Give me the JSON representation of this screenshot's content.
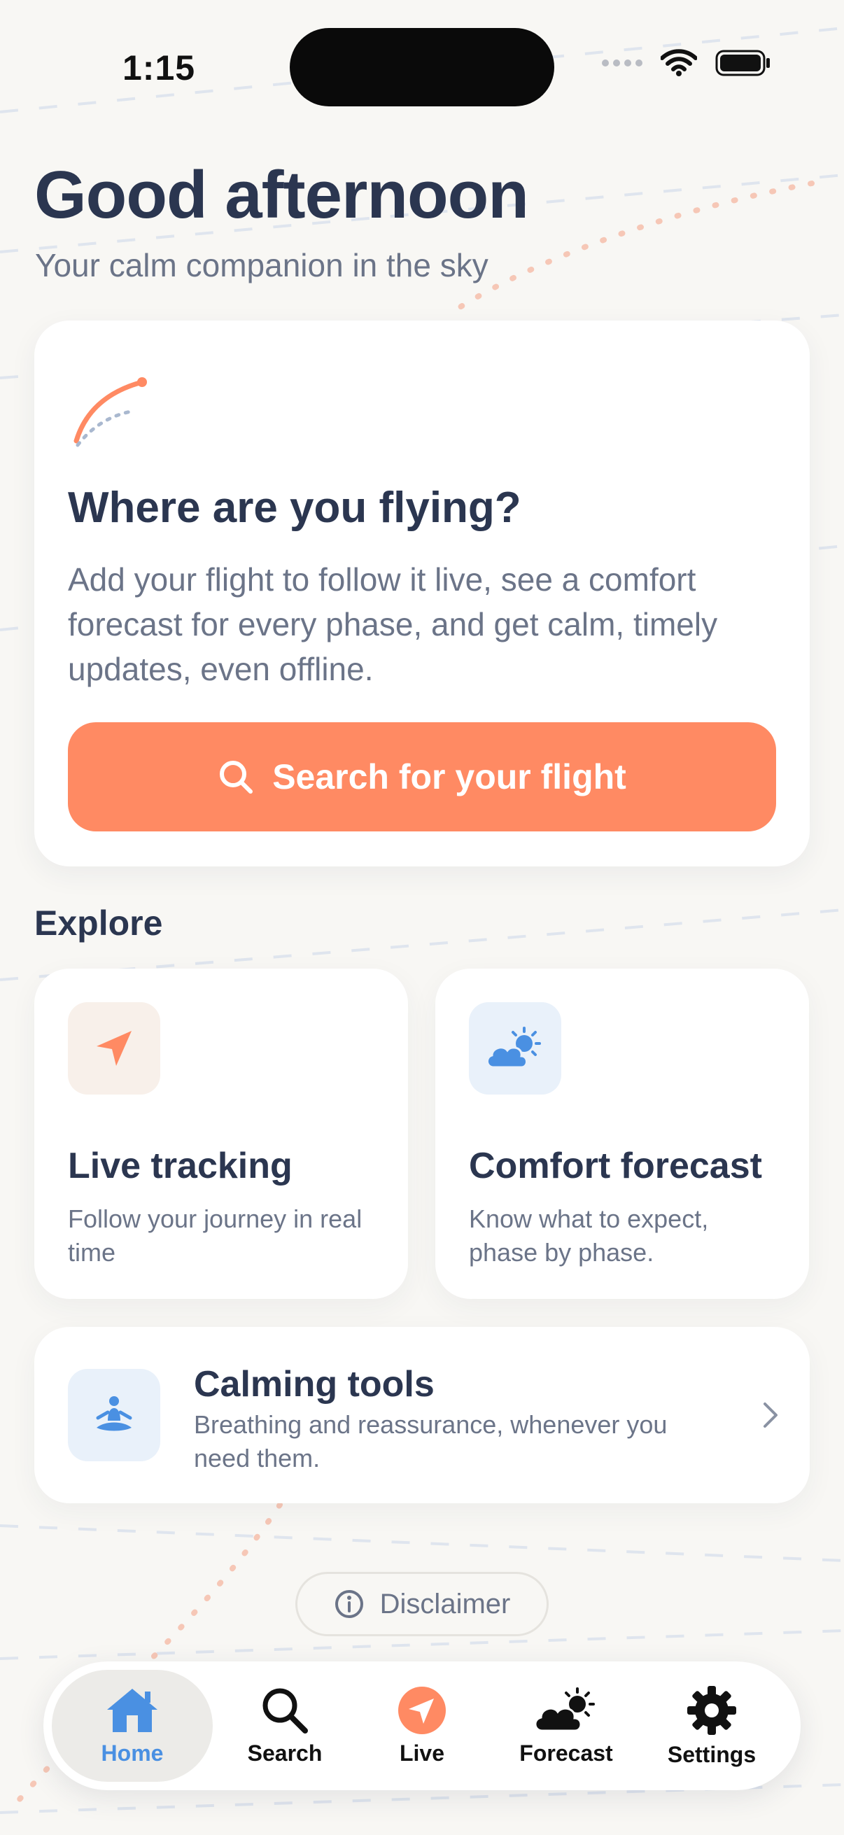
{
  "status_bar": {
    "time": "1:15"
  },
  "header": {
    "greeting": "Good afternoon",
    "tagline": "Your calm companion in the sky"
  },
  "hero": {
    "title": "Where are you flying?",
    "body": "Add your flight to follow it live, see a comfort forecast for every phase, and get calm, timely updates, even offline.",
    "cta_label": "Search for your flight",
    "cta_icon": "search-icon"
  },
  "explore": {
    "title": "Explore",
    "tiles": [
      {
        "title": "Live tracking",
        "description": "Follow your journey in real time",
        "icon": "navigation-arrow-icon"
      },
      {
        "title": "Comfort forecast",
        "description": "Know what to expect, phase by phase.",
        "icon": "partly-cloudy-icon"
      }
    ],
    "calming": {
      "title": "Calming tools",
      "description": "Breathing and reassurance, whenever you need them.",
      "icon": "meditation-icon"
    }
  },
  "disclaimer": {
    "label": "Disclaimer",
    "icon": "info-icon"
  },
  "tabbar": {
    "tabs": [
      {
        "label": "Home",
        "icon": "house-icon",
        "active": true
      },
      {
        "label": "Search",
        "icon": "search-icon",
        "active": false
      },
      {
        "label": "Live",
        "icon": "navigation-arrow-icon",
        "active": false
      },
      {
        "label": "Forecast",
        "icon": "partly-cloudy-icon",
        "active": false
      },
      {
        "label": "Settings",
        "icon": "gear-icon",
        "active": false
      }
    ]
  },
  "colors": {
    "accent": "#ff8a63",
    "primary_text": "#2b3650",
    "secondary_text": "#6b7488",
    "active_tab": "#4a90e2",
    "background": "#f8f7f4"
  }
}
